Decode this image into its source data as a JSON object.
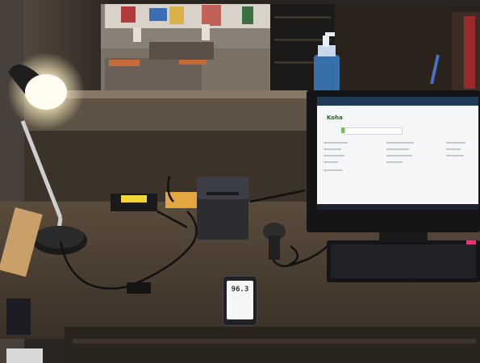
{
  "scene": {
    "monitor": {
      "screen_title": "",
      "app_logo": "Koha"
    },
    "phone": {
      "reading": "96.3"
    }
  },
  "colors": {
    "desk": "#4a3f33",
    "counter_top": "#6d6152",
    "lamp_light": "#fff6dd",
    "screen_bg": "#f4f6f8",
    "label_yellow": "#f2d63a",
    "sanitizer_blue": "#3b7fc4"
  }
}
